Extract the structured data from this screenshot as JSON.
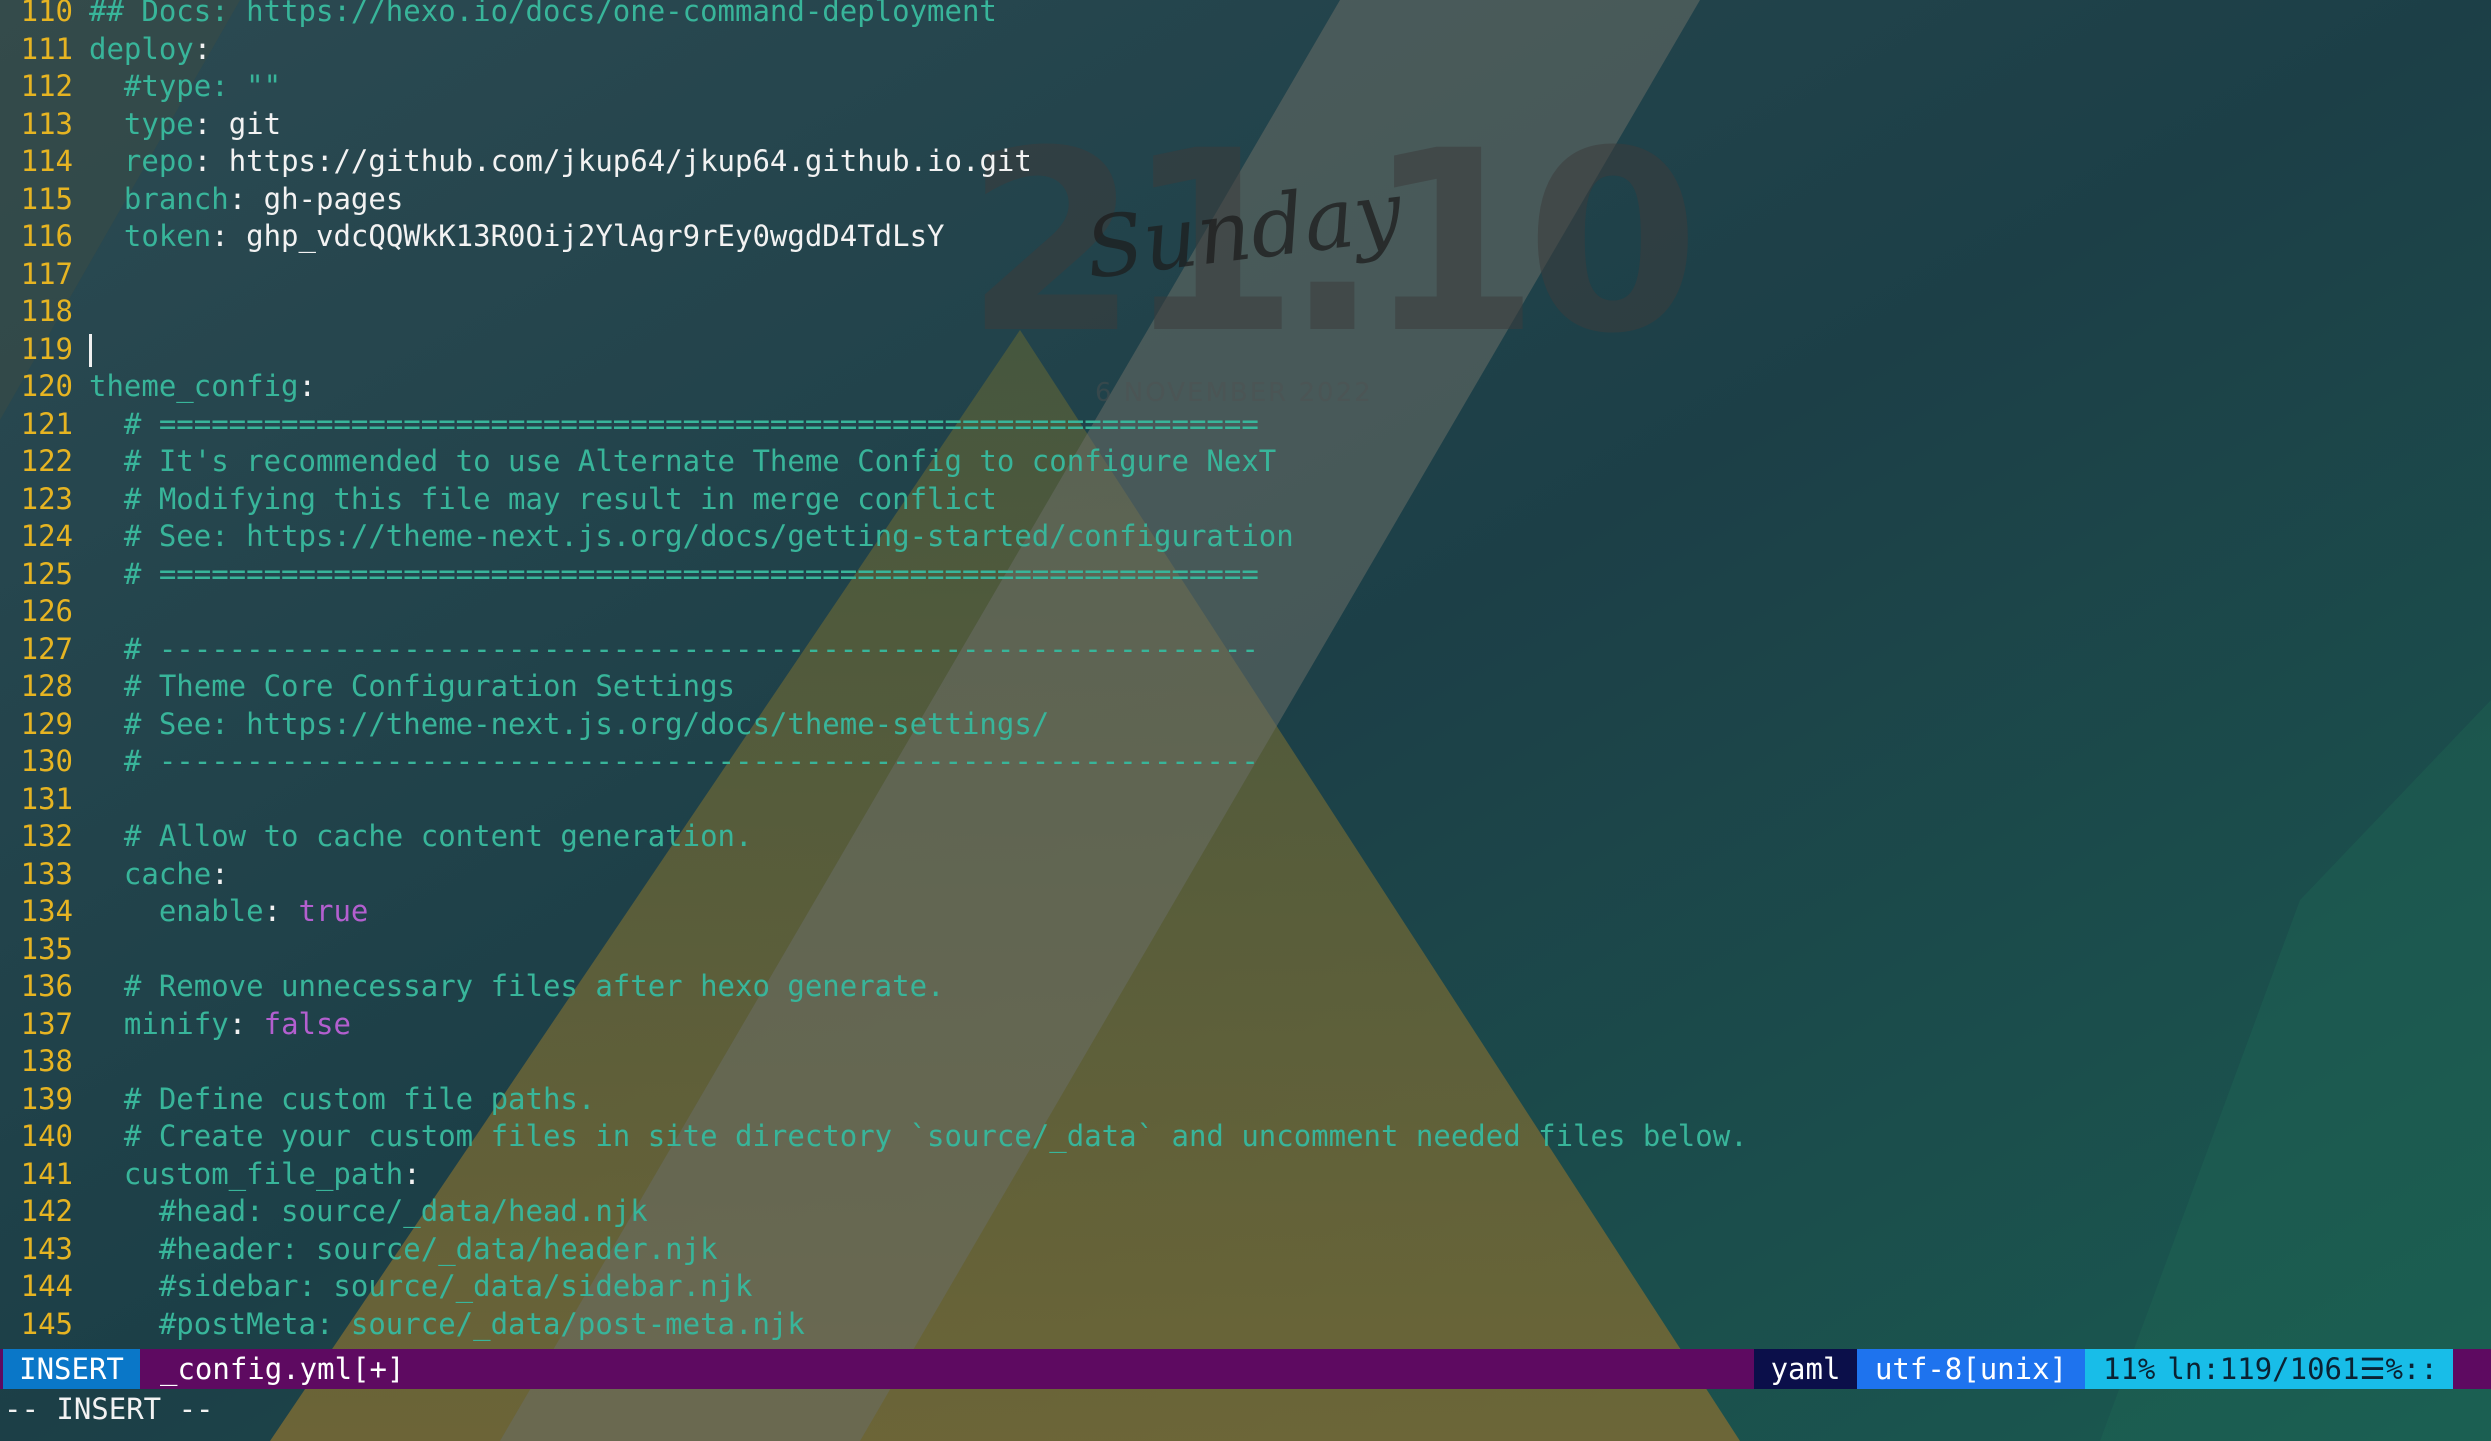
{
  "wallpaper": {
    "clock_time": "21.10",
    "clock_day": "Sunday",
    "clock_date": "6 NOVEMBER 2022"
  },
  "editor": {
    "lines": [
      {
        "n": "110",
        "segments": [
          {
            "t": "cm",
            "s": "## Docs: https://hexo.io/docs/one-command-deployment"
          }
        ]
      },
      {
        "n": "111",
        "segments": [
          {
            "t": "key",
            "s": "deploy"
          },
          {
            "t": "punct",
            "s": ":"
          }
        ]
      },
      {
        "n": "112",
        "segments": [
          {
            "t": "cm",
            "s": "  #type: \"\""
          }
        ]
      },
      {
        "n": "113",
        "segments": [
          {
            "t": "key",
            "s": "  type"
          },
          {
            "t": "punct",
            "s": ": "
          },
          {
            "t": "val",
            "s": "git"
          }
        ]
      },
      {
        "n": "114",
        "segments": [
          {
            "t": "key",
            "s": "  repo"
          },
          {
            "t": "punct",
            "s": ": "
          },
          {
            "t": "val",
            "s": "https://github.com/jkup64/jkup64.github.io.git"
          }
        ]
      },
      {
        "n": "115",
        "segments": [
          {
            "t": "key",
            "s": "  branch"
          },
          {
            "t": "punct",
            "s": ": "
          },
          {
            "t": "val",
            "s": "gh-pages"
          }
        ]
      },
      {
        "n": "116",
        "segments": [
          {
            "t": "key",
            "s": "  token"
          },
          {
            "t": "punct",
            "s": ": "
          },
          {
            "t": "val",
            "s": "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"
          }
        ]
      },
      {
        "n": "117",
        "segments": []
      },
      {
        "n": "118",
        "segments": []
      },
      {
        "n": "119",
        "segments": [],
        "cursor": true
      },
      {
        "n": "120",
        "segments": [
          {
            "t": "key",
            "s": "theme_config"
          },
          {
            "t": "punct",
            "s": ":"
          }
        ]
      },
      {
        "n": "121",
        "segments": [
          {
            "t": "cm",
            "s": "  # ==============================================================="
          }
        ]
      },
      {
        "n": "122",
        "segments": [
          {
            "t": "cm",
            "s": "  # It's recommended to use Alternate Theme Config to configure NexT"
          }
        ]
      },
      {
        "n": "123",
        "segments": [
          {
            "t": "cm",
            "s": "  # Modifying this file may result in merge conflict"
          }
        ]
      },
      {
        "n": "124",
        "segments": [
          {
            "t": "cm",
            "s": "  # See: https://theme-next.js.org/docs/getting-started/configuration"
          }
        ]
      },
      {
        "n": "125",
        "segments": [
          {
            "t": "cm",
            "s": "  # ==============================================================="
          }
        ]
      },
      {
        "n": "126",
        "segments": []
      },
      {
        "n": "127",
        "segments": [
          {
            "t": "cm",
            "s": "  # ---------------------------------------------------------------"
          }
        ]
      },
      {
        "n": "128",
        "segments": [
          {
            "t": "cm",
            "s": "  # Theme Core Configuration Settings"
          }
        ]
      },
      {
        "n": "129",
        "segments": [
          {
            "t": "cm",
            "s": "  # See: https://theme-next.js.org/docs/theme-settings/"
          }
        ]
      },
      {
        "n": "130",
        "segments": [
          {
            "t": "cm",
            "s": "  # ---------------------------------------------------------------"
          }
        ]
      },
      {
        "n": "131",
        "segments": []
      },
      {
        "n": "132",
        "segments": [
          {
            "t": "cm",
            "s": "  # Allow to cache content generation."
          }
        ]
      },
      {
        "n": "133",
        "segments": [
          {
            "t": "key",
            "s": "  cache"
          },
          {
            "t": "punct",
            "s": ":"
          }
        ]
      },
      {
        "n": "134",
        "segments": [
          {
            "t": "key",
            "s": "    enable"
          },
          {
            "t": "punct",
            "s": ": "
          },
          {
            "t": "bool",
            "s": "true"
          }
        ]
      },
      {
        "n": "135",
        "segments": []
      },
      {
        "n": "136",
        "segments": [
          {
            "t": "cm",
            "s": "  # Remove unnecessary files after hexo generate."
          }
        ]
      },
      {
        "n": "137",
        "segments": [
          {
            "t": "key",
            "s": "  minify"
          },
          {
            "t": "punct",
            "s": ": "
          },
          {
            "t": "bool",
            "s": "false"
          }
        ]
      },
      {
        "n": "138",
        "segments": []
      },
      {
        "n": "139",
        "segments": [
          {
            "t": "cm",
            "s": "  # Define custom file paths."
          }
        ]
      },
      {
        "n": "140",
        "segments": [
          {
            "t": "cm",
            "s": "  # Create your custom files in site directory `source/_data` and uncomment needed files below."
          }
        ]
      },
      {
        "n": "141",
        "segments": [
          {
            "t": "key",
            "s": "  custom_file_path"
          },
          {
            "t": "punct",
            "s": ":"
          }
        ]
      },
      {
        "n": "142",
        "segments": [
          {
            "t": "cm",
            "s": "    #head: source/_data/head.njk"
          }
        ]
      },
      {
        "n": "143",
        "segments": [
          {
            "t": "cm",
            "s": "    #header: source/_data/header.njk"
          }
        ]
      },
      {
        "n": "144",
        "segments": [
          {
            "t": "cm",
            "s": "    #sidebar: source/_data/sidebar.njk"
          }
        ]
      },
      {
        "n": "145",
        "segments": [
          {
            "t": "cm",
            "s": "    #postMeta: source/_data/post-meta.njk"
          }
        ]
      }
    ]
  },
  "statusline": {
    "mode": "INSERT",
    "filename": "_config.yml[+]",
    "filetype": "yaml",
    "encoding": "utf-8[unix]",
    "percent": "11%",
    "line_glyph": "ln",
    "position": ":119/1061",
    "menu_glyph": "☰",
    "col_suffix": "%::"
  },
  "cmdline": {
    "text": "-- INSERT --"
  },
  "colors": {
    "line_number": "#e6b422",
    "comment": "#38b59a",
    "key": "#38b59a",
    "boolean": "#b35fcf",
    "statusline_bg": "#5e0a61",
    "mode_bg": "#0a77c8",
    "filetype_bg": "#0b0f4a",
    "encoding_bg": "#1e73ee",
    "position_bg": "#18bde8"
  }
}
